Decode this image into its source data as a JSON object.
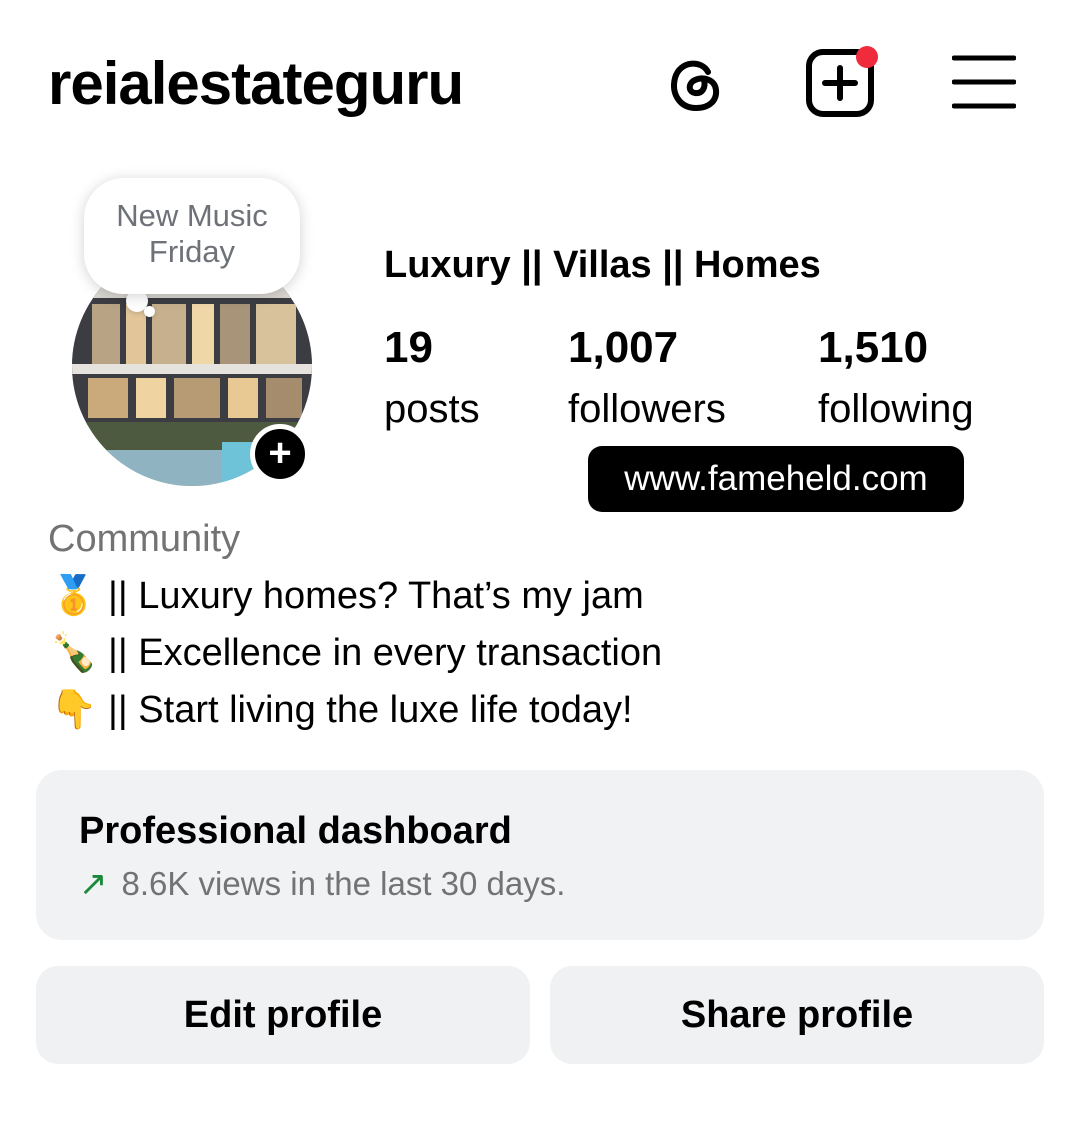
{
  "header": {
    "username": "reialestateguru",
    "icons": [
      "threads-icon",
      "create-post-icon",
      "menu-icon"
    ],
    "notification_color": "#ef2b3c"
  },
  "profile": {
    "note": "New Music Friday",
    "display_name": "Luxury || Villas || Homes",
    "stats": [
      {
        "count": "19",
        "label": "posts"
      },
      {
        "count": "1,007",
        "label": "followers"
      },
      {
        "count": "1,510",
        "label": "following"
      }
    ],
    "website_badge": "www.fameheld.com",
    "category": "Community",
    "bio": [
      {
        "emoji": "🥇",
        "text": "|| Luxury homes? That’s my jam"
      },
      {
        "emoji": "🍾",
        "text": "|| Excellence in every transaction"
      },
      {
        "emoji": "👇",
        "text": "|| Start living the luxe life today!"
      }
    ]
  },
  "dashboard": {
    "title": "Professional dashboard",
    "trend_icon": "trend-up-arrow-icon",
    "subtitle": "8.6K views in the last 30 days.",
    "trend_color": "#1a8a3a"
  },
  "buttons": {
    "edit": "Edit profile",
    "share": "Share profile"
  }
}
